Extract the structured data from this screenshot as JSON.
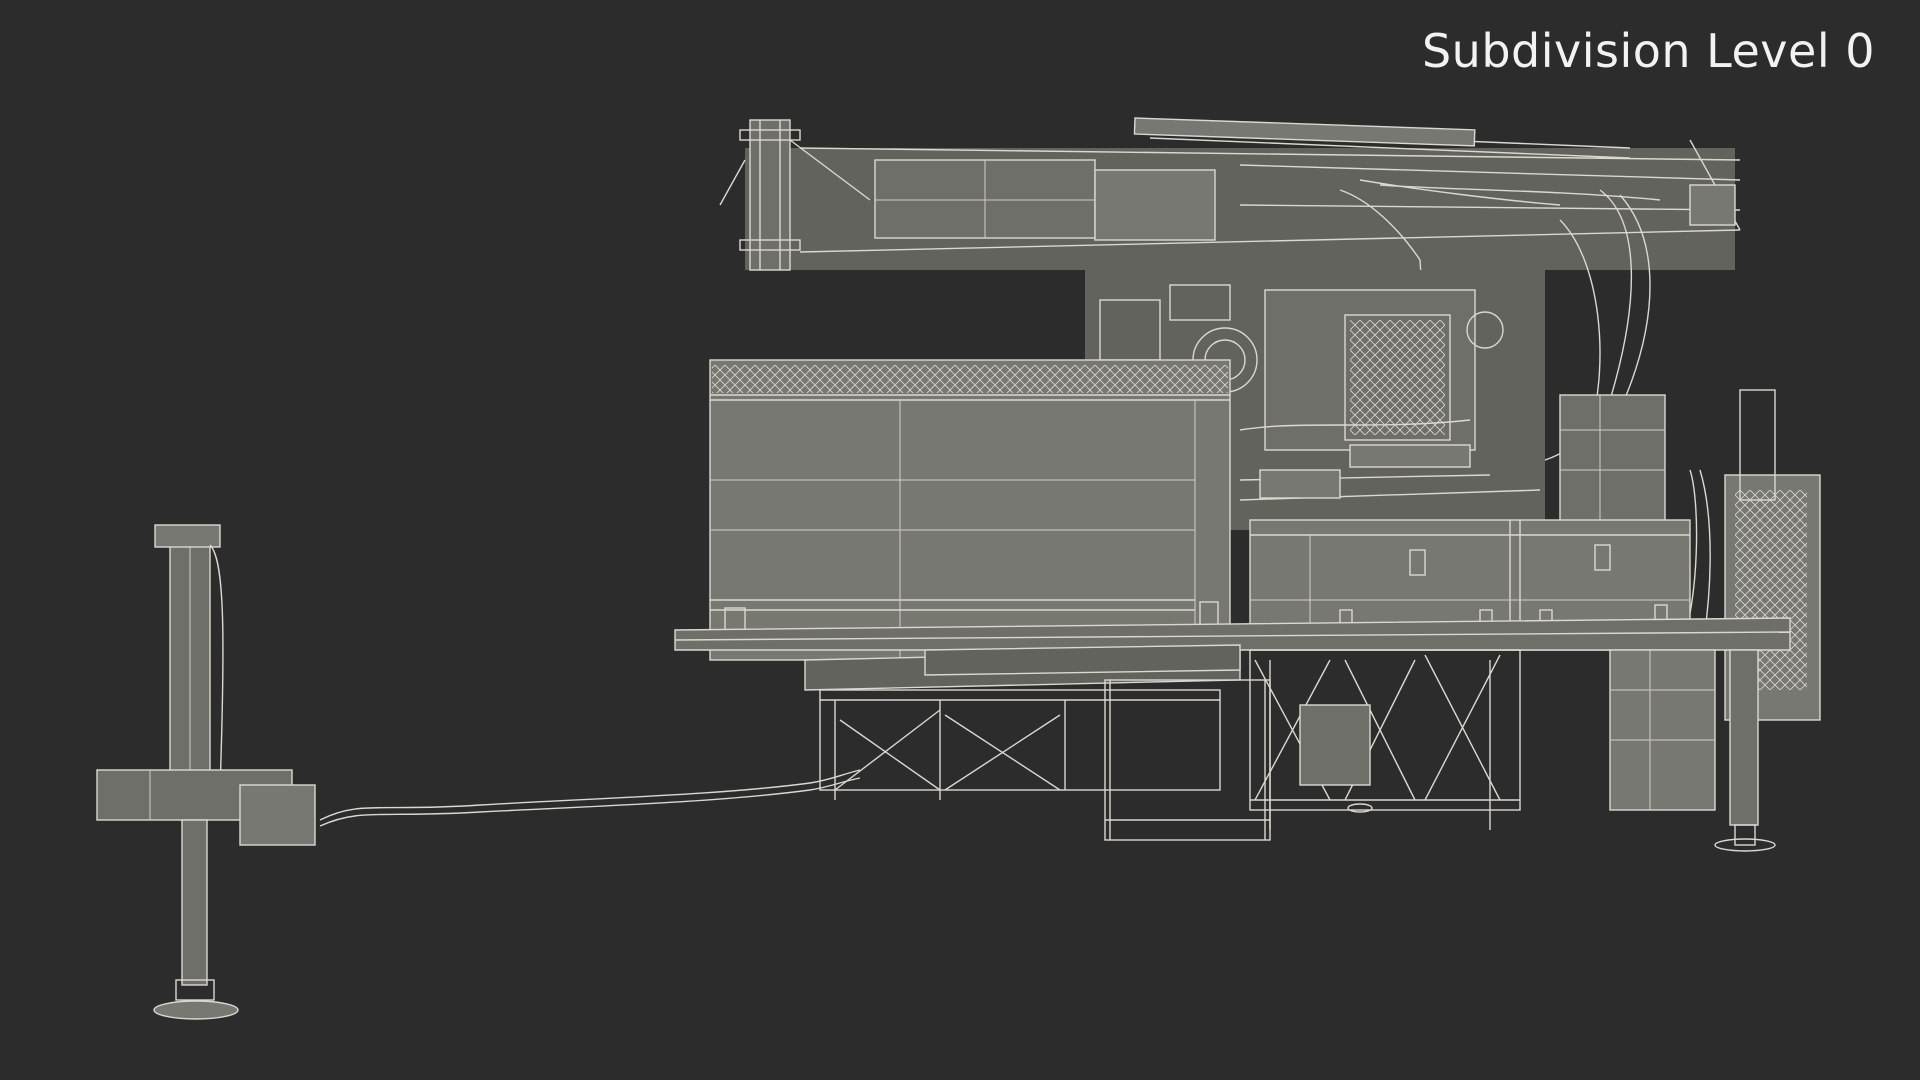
{
  "render": {
    "caption": "Subdivision Level 0",
    "background": "#2c2c2c",
    "surface_color": "#6f6f69",
    "wire_color": "#d9d9d0"
  }
}
